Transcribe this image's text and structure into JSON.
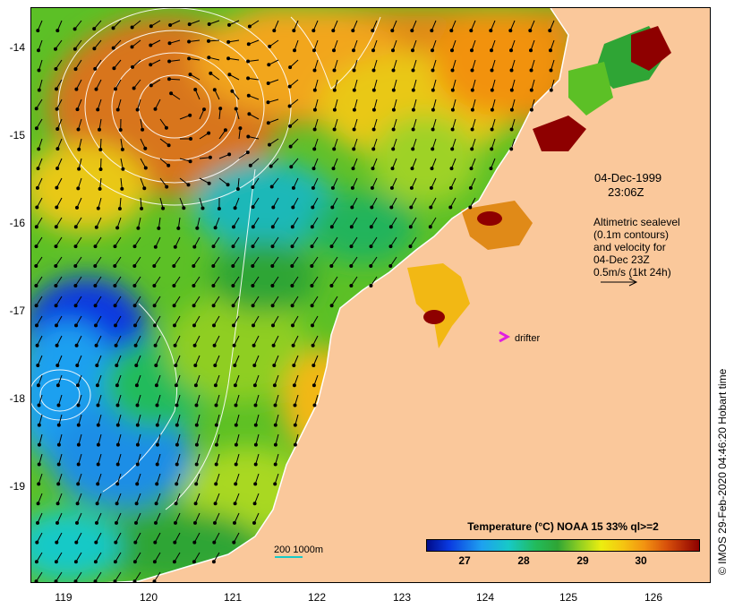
{
  "map": {
    "date": "04-Dec-1999",
    "time": "23:06Z",
    "sealevel_note": [
      "Altimetric sealevel",
      "(0.1m contours)",
      "and velocity for",
      "04-Dec 23Z",
      "0.5m/s (1kt 24h)"
    ],
    "drifter_label": "drifter",
    "scale_label": "200  1000m",
    "credit": "© IMOS 29-Feb-2020 04:46:20 Hobart time",
    "lat_labels": [
      "-14",
      "-15",
      "-16",
      "-17",
      "-18",
      "-19"
    ],
    "lon_labels": [
      "119",
      "120",
      "121",
      "122",
      "123",
      "124",
      "125",
      "126"
    ],
    "colorbar": {
      "title": "Temperature (°C) NOAA 15 33% ql>=2",
      "ticks": [
        "27",
        "28",
        "29",
        "30"
      ]
    },
    "colors": {
      "land": "#fac89b",
      "drifter": "#e020e0",
      "warm": "#e07a10",
      "hot": "#8e0000",
      "cool": "#1ea0f0",
      "cold": "#0a39e0",
      "mid": "#2fa535"
    }
  }
}
